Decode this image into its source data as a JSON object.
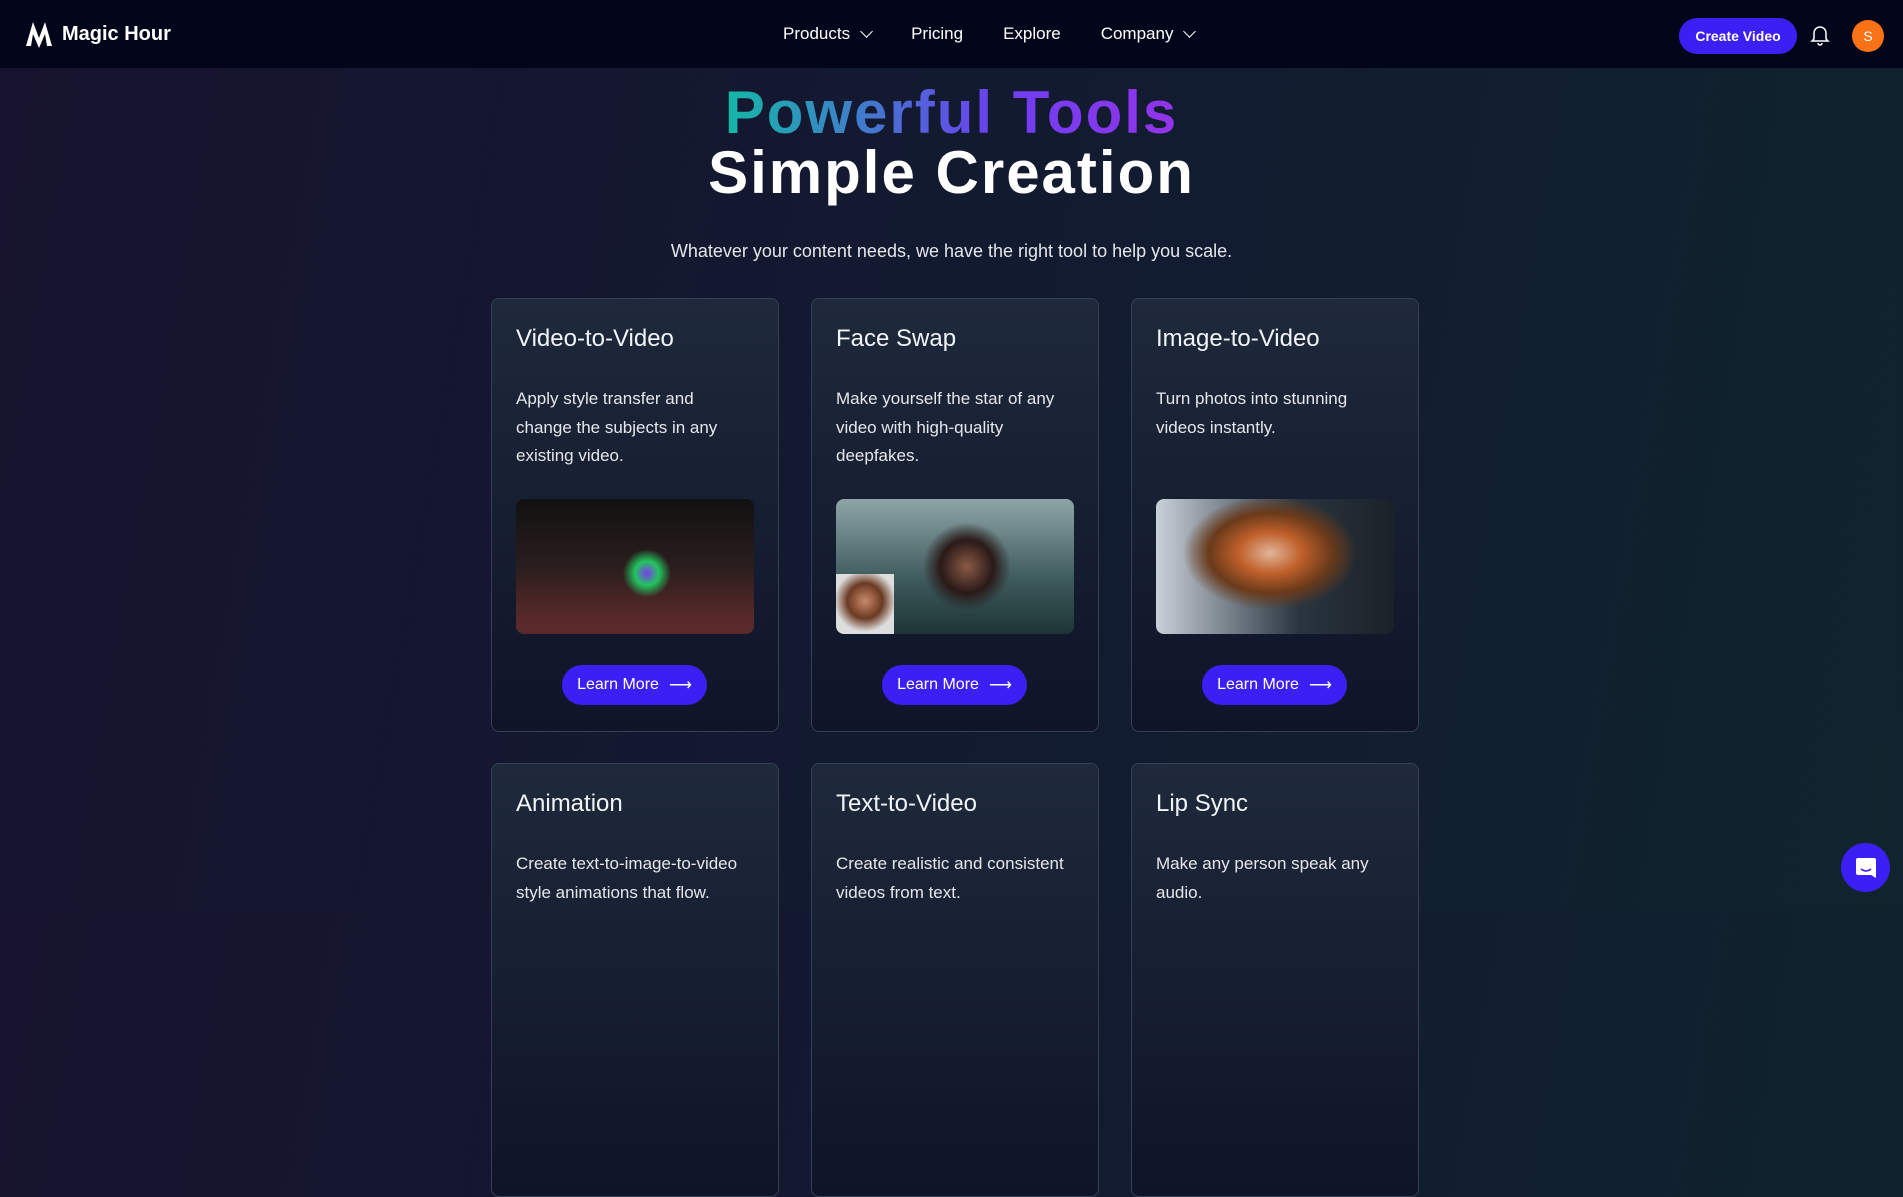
{
  "nav": {
    "brand": "Magic Hour",
    "items": [
      {
        "label": "Products",
        "dropdown": true
      },
      {
        "label": "Pricing"
      },
      {
        "label": "Explore"
      },
      {
        "label": "Company",
        "dropdown": true
      }
    ],
    "cta": "Create Video",
    "avatar_initial": "S",
    "accent": "#3b1ff5",
    "avatar_color": "#f97316"
  },
  "hero": {
    "title_line1": "Powerful Tools",
    "title_line2": "Simple Creation",
    "subtitle": "Whatever your content needs, we have the right tool to help you scale."
  },
  "cards": [
    {
      "title": "Video-to-Video",
      "description": "Apply style transfer and change the subjects in any existing video.",
      "button": "Learn More"
    },
    {
      "title": "Face Swap",
      "description": "Make yourself the star of any video with high-quality deepfakes.",
      "button": "Learn More"
    },
    {
      "title": "Image-to-Video",
      "description": "Turn photos into stunning videos instantly.",
      "button": "Learn More"
    },
    {
      "title": "Animation",
      "description": "Create text-to-image-to-video style animations that flow."
    },
    {
      "title": "Text-to-Video",
      "description": "Create realistic and consistent videos from text."
    },
    {
      "title": "Lip Sync",
      "description": "Make any person speak any audio."
    }
  ]
}
